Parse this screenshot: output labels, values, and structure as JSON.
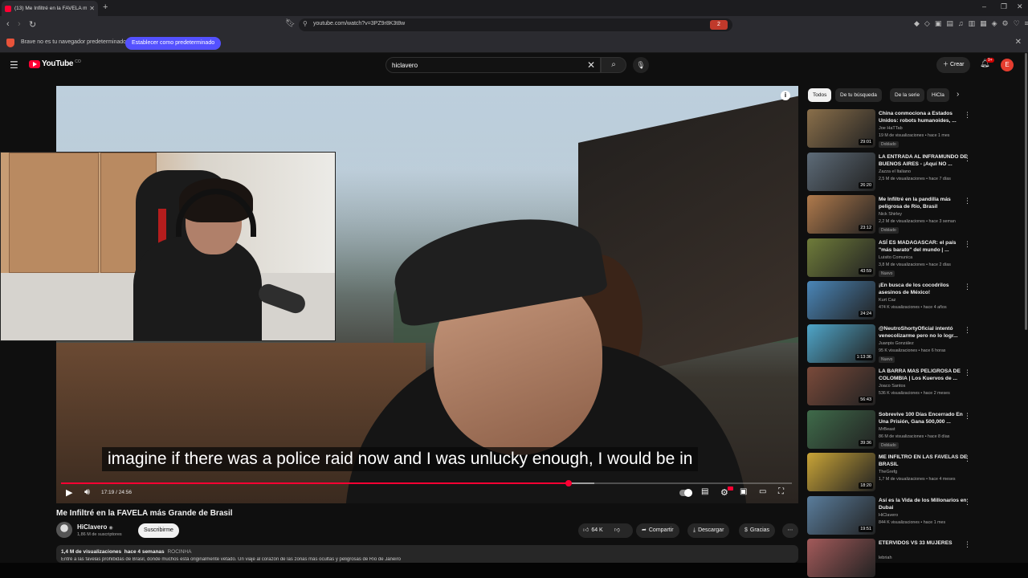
{
  "browser": {
    "tab_title": "(13) Me Infiltré en la FAVELA más",
    "url": "youtube.com/watch?v=3PZ9r8K3t8w",
    "shield_count": "2"
  },
  "infobar": {
    "message": "Brave no es tu navegador predeterminado",
    "button": "Establecer como predeterminado"
  },
  "header": {
    "logo": "YouTube",
    "logo_country": "CO",
    "search_value": "hiclavero",
    "create_label": "Crear",
    "notif_count": "9+",
    "avatar_letter": "E"
  },
  "player": {
    "caption": "imagine if there was a police raid now and I was unlucky enough, I would be in",
    "time": "17:19 / 24:56",
    "progress": 0.6946,
    "buffered": 0.73
  },
  "video": {
    "title": "Me Infiltré en la FAVELA más Grande de Brasil",
    "channel": "HiClavero",
    "subscribers": "1,86 M de suscriptores",
    "subscribe": "Suscribirme",
    "likes": "64 K",
    "share": "Compartir",
    "download": "Descargar",
    "thanks": "Gracias",
    "views": "1,4 M de visualizaciones",
    "age": "hace 4 semanas",
    "tag": "ROCINHA",
    "description": "Entré a las favelas prohibidas de Brasil, donde muchos está originalmente vetado. Un viaje al corazón de las zonas más ocultas y peligrosas de Río de Janeiro"
  },
  "chips": [
    "Todos",
    "De tu búsqueda",
    "De la serie",
    "HiCla"
  ],
  "recommendations": [
    {
      "title": "China conmociona a Estados Unidos: robots humanoides, ...",
      "channel": "Joe HaTTab",
      "meta": "19 M de visualizaciones • hace 1 mes",
      "duration": "29:01",
      "badge": "Doblado",
      "color": "#8a6f4a"
    },
    {
      "title": "LA ENTRADA AL INFRAMUNDO DE BUENOS AIRES - ¡Aquí NO ...",
      "channel": "Zazza el Italiano",
      "meta": "2,5 M de visualizaciones • hace 7 días",
      "duration": "26:20",
      "badge": "",
      "color": "#5d6b78"
    },
    {
      "title": "Me Infiltré en la pandilla más peligrosa de Río, Brasil",
      "channel": "Nick Shirley",
      "meta": "2,2 M de visualizaciones • hace 3 seman",
      "duration": "23:12",
      "badge": "Doblado",
      "color": "#b07a4c"
    },
    {
      "title": "ASÍ ES MADAGASCAR: el país \"más barato\" del mundo | ...",
      "channel": "Luisito Comunica",
      "meta": "3,8 M de visualizaciones • hace 2 días",
      "duration": "43:59",
      "badge": "Nuevo",
      "color": "#6f7c3a"
    },
    {
      "title": "¡En busca de los cocodrilos asesinos de México!",
      "channel": "Kurt Caz",
      "meta": "474 K visualizaciones • hace 4 años",
      "duration": "24:24",
      "badge": "",
      "color": "#4a86b8"
    },
    {
      "title": "@NeutroShortyOficial intentó venecolizarme pero no lo logr...",
      "channel": "Juanpis González",
      "meta": "95 K visualizaciones • hace 6 horas",
      "duration": "1:13:36",
      "badge": "Nuevo",
      "color": "#4fa6c9"
    },
    {
      "title": "LA BARRA MAS PELIGROSA DE COLOMBIA | Los Kuervos de ...",
      "channel": "Joaco Santos",
      "meta": "536 K visualizaciones • hace 2 meses",
      "duration": "56:43",
      "badge": "",
      "color": "#7a4a3a"
    },
    {
      "title": "Sobrevive 100 Días Encerrado En Una Prisión, Gana 500,000 ...",
      "channel": "MrBeast",
      "meta": "86 M de visualizaciones • hace 8 días",
      "duration": "39:36",
      "badge": "Doblado",
      "color": "#3f6b4a"
    },
    {
      "title": "ME INFILTRO EN LAS FAVELAS DE BRASIL",
      "channel": "TheGrefg",
      "meta": "1,7 M de visualizaciones • hace 4 meses",
      "duration": "18:20",
      "badge": "",
      "color": "#c9a437"
    },
    {
      "title": "Así es la Vida de los Millonarios en Dubai",
      "channel": "HiClavero",
      "meta": "844 K visualizaciones • hace 1 mes",
      "duration": "19:51",
      "badge": "",
      "color": "#5a7d9c"
    },
    {
      "title": "ETERVIDOS VS 33 MUJERES",
      "channel": "lebriah",
      "meta": "",
      "duration": "",
      "badge": "",
      "color": "#a35a5a"
    }
  ]
}
